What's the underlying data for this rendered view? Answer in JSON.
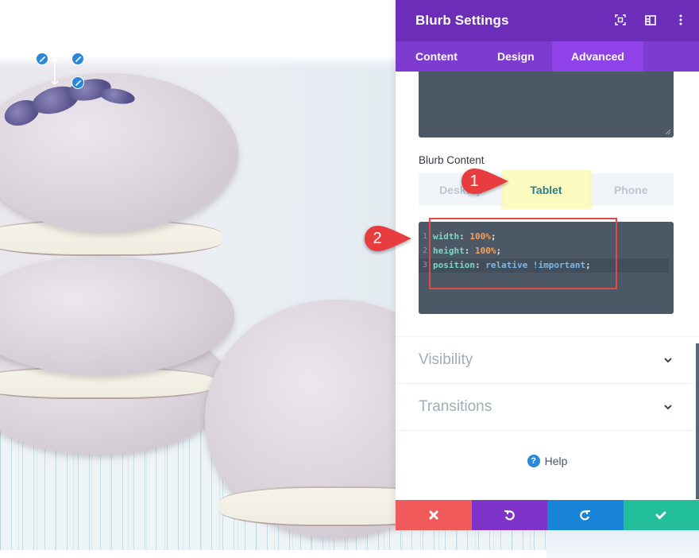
{
  "panel": {
    "title": "Blurb Settings",
    "header_icons": [
      "focus-icon",
      "split-view-icon",
      "more-options-icon"
    ],
    "tabs": [
      {
        "label": "Content",
        "active": false
      },
      {
        "label": "Design",
        "active": false
      },
      {
        "label": "Advanced",
        "active": true
      }
    ],
    "field_label": "Blurb Content",
    "device_tabs": [
      {
        "label": "Desktop",
        "active": false
      },
      {
        "label": "Tablet",
        "active": true
      },
      {
        "label": "Phone",
        "active": false
      }
    ],
    "code_lines": [
      {
        "number": "1",
        "property": "width",
        "value": "100%",
        "suffix": ""
      },
      {
        "number": "2",
        "property": "height",
        "value": "100%",
        "suffix": ""
      },
      {
        "number": "3",
        "property": "position",
        "value": "relative",
        "suffix": "!important"
      }
    ],
    "sections": [
      {
        "label": "Visibility"
      },
      {
        "label": "Transitions"
      }
    ],
    "help_label": "Help"
  },
  "actions": {
    "discard": "discard-icon",
    "undo": "undo-icon",
    "redo": "redo-icon",
    "save": "save-icon"
  },
  "callouts": [
    "1",
    "2"
  ],
  "colors": {
    "header_purple": "#6c2eb9",
    "tab_purple": "#7e3bd0",
    "active_tab_purple": "#8f42e7",
    "code_bg": "#4c5866",
    "discard_red": "#f05a5a",
    "undo_purple": "#7e34c8",
    "redo_blue": "#1784d8",
    "save_green": "#23bf9b",
    "callout_red": "#e83d3f",
    "highlight_yellow": "#fcfcc0"
  }
}
